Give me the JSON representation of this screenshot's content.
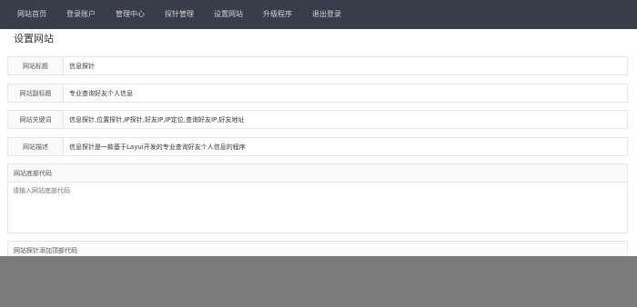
{
  "nav": {
    "items": [
      "网站首页",
      "登录账户",
      "管理中心",
      "探针管理",
      "设置网站",
      "升级程序",
      "退出登录"
    ]
  },
  "page": {
    "title": "设置网站"
  },
  "fields": [
    {
      "label": "网站标题",
      "value": "信息探针"
    },
    {
      "label": "网站副标题",
      "value": "专业查询好友个人信息"
    },
    {
      "label": "网站关键词",
      "value": "信息探针,位置探针,IP探针,好友IP,IP定位,查询好友IP,好友地址"
    },
    {
      "label": "网站描述",
      "value": "信息探针是一款基于Layui开发的专业查询好友个人信息的程序"
    }
  ],
  "footer_code": {
    "label": "网站底部代码",
    "placeholder": "请输入网站底部代码"
  },
  "probe_code": {
    "label": "网站探针添加顶部代码"
  },
  "colors": {
    "nav_bg": "#393d49",
    "nav_text": "#d2d2d2",
    "overlay": "#7b7b7b"
  }
}
